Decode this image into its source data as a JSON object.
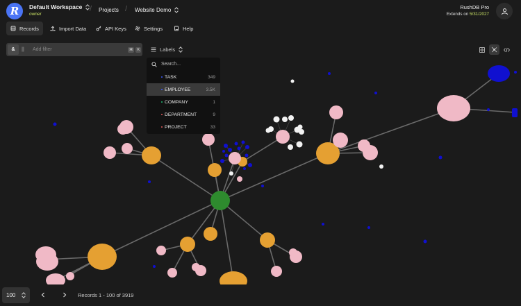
{
  "workspace": {
    "name": "Default Workspace",
    "role": "owner"
  },
  "breadcrumbs": [
    "Projects",
    "Website Demo"
  ],
  "plan": {
    "title": "RushDB Pro",
    "extends_label": "Extends on",
    "extends_date": "5/31/2027"
  },
  "nav": [
    {
      "label": "Records",
      "icon": "database-icon",
      "active": true
    },
    {
      "label": "Import Data",
      "icon": "upload-icon",
      "active": false
    },
    {
      "label": "API Keys",
      "icon": "key-icon",
      "active": false
    },
    {
      "label": "Settings",
      "icon": "gear-icon",
      "active": false
    },
    {
      "label": "Help",
      "icon": "book-icon",
      "active": false
    }
  ],
  "filter": {
    "and": "&",
    "or": "||",
    "placeholder": "Add filter",
    "kbd1": "⌘",
    "kbd2": "K"
  },
  "labels_button": "Labels",
  "dropdown": {
    "search_placeholder": "Search...",
    "items": [
      {
        "label": "TASK",
        "count": "349",
        "color": "#3b5bff",
        "active": false
      },
      {
        "label": "EMPLOYEE",
        "count": "3.5K",
        "color": "#3b5bff",
        "active": true
      },
      {
        "label": "COMPANY",
        "count": "1",
        "color": "#22b573",
        "active": false
      },
      {
        "label": "DEPARTMENT",
        "count": "9",
        "color": "#e05a5a",
        "active": false
      },
      {
        "label": "PROJECT",
        "count": "33",
        "color": "#e05a5a",
        "active": false
      }
    ]
  },
  "footer": {
    "page_size": "100",
    "records": "Records 1 - 100 of 3919"
  },
  "colors": {
    "accent": "#4a74f5",
    "highlight": "#c9e265",
    "company": "#2e8b2e",
    "department": "#e5a032",
    "project": "#f0b9c6",
    "task": "#1010d0",
    "employee": "#f2f2f2"
  }
}
